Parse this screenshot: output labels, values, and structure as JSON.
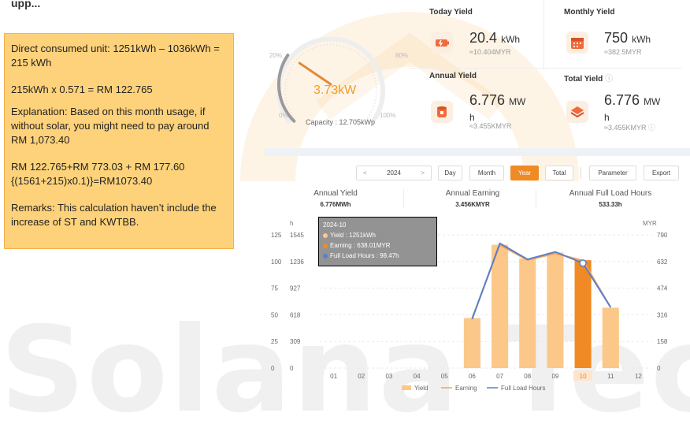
{
  "top_title": "upp...",
  "note": {
    "line1": "Direct consumed unit: 1251kWh – 1036kWh = 215 kWh",
    "line2": "215kWh x 0.571 = RM 122.765",
    "line3": "Explanation: Based on this month usage, if without solar, you might need to pay around RM 1,073.40",
    "line4": "RM 122.765+RM 773.03 + RM 177.60 {(1561+215)x0.1)}=RM1073.40",
    "line5": "Remarks: This calculation haven’t include the increase of ST and KWTBB."
  },
  "gauge": {
    "value": "3.73kW",
    "fraction": 0.293,
    "tick_20": "20%",
    "tick_80": "80%",
    "tick_0": "0%",
    "tick_100": "100%",
    "capacity": "Capacity : 12.705kWp"
  },
  "cards": {
    "today": {
      "title": "Today Yield",
      "value": "20.4",
      "unit": "kWh",
      "sub": "≈10.404MYR"
    },
    "monthly": {
      "title": "Monthly Yield",
      "value": "750",
      "unit": "kWh",
      "sub": "≈382.5MYR"
    },
    "annual": {
      "title": "Annual Yield",
      "value": "6.776",
      "unit": "MW",
      "unit2": "h",
      "sub": "≈3.455KMYR"
    },
    "total": {
      "title": "Total Yield",
      "value": "6.776",
      "unit": "MW",
      "unit2": "h",
      "sub": "≈3.455KMYR"
    }
  },
  "controls": {
    "prev": "<",
    "year": "2024",
    "next": ">",
    "day": "Day",
    "month": "Month",
    "year_tab": "Year",
    "total": "Total",
    "parameter": "Parameter",
    "export": "Export"
  },
  "stats": {
    "annual_yield_label": "Annual Yield",
    "annual_yield_value": "6.776MWh",
    "annual_earning_label": "Annual Earning",
    "annual_earning_value": "3.456KMYR",
    "full_load_label": "Annual Full Load Hours",
    "full_load_value": "533.33h"
  },
  "tooltip": {
    "title": "2024-10",
    "yield": "Yield :  1251kWh",
    "earning": "Earning :  638.01MYR",
    "flh": "Full Load Hours :  98.47h"
  },
  "colors": {
    "accent": "#f08a24",
    "bar": "#fbc889",
    "bar_active": "#f08a24",
    "earning_line": "#f5a35c",
    "flh_line": "#5b7fc7"
  },
  "chart_data": {
    "type": "bar",
    "left_axis_unit": "h",
    "right_axis_unit": "MYR",
    "categories": [
      "01",
      "02",
      "03",
      "04",
      "05",
      "06",
      "07",
      "08",
      "09",
      "10",
      "11",
      "12"
    ],
    "h_ticks": [
      "125",
      "100",
      "75",
      "50",
      "25",
      "0"
    ],
    "yield_ticks": [
      "1545",
      "1236",
      "927",
      "618",
      "309",
      "0"
    ],
    "myr_ticks": [
      "790",
      "632",
      "474",
      "316",
      "158",
      "0"
    ],
    "h_max": 125,
    "myr_max": 790,
    "highlight_index": 9,
    "series": [
      {
        "name": "Yield",
        "axis": "left_kwh",
        "values": [
          null,
          null,
          null,
          null,
          null,
          580,
          1430,
          1270,
          1340,
          1251,
          700,
          null
        ]
      },
      {
        "name": "Earning",
        "axis": "right_myr",
        "values": [
          null,
          null,
          null,
          null,
          null,
          296,
          730,
          640,
          680,
          638,
          360,
          null
        ]
      },
      {
        "name": "Full Load Hours",
        "axis": "left_h",
        "values": [
          null,
          null,
          null,
          null,
          null,
          46,
          117,
          102,
          109,
          98.47,
          57,
          null
        ]
      }
    ],
    "legend": [
      "Yield",
      "Earning",
      "Full Load Hours"
    ]
  }
}
